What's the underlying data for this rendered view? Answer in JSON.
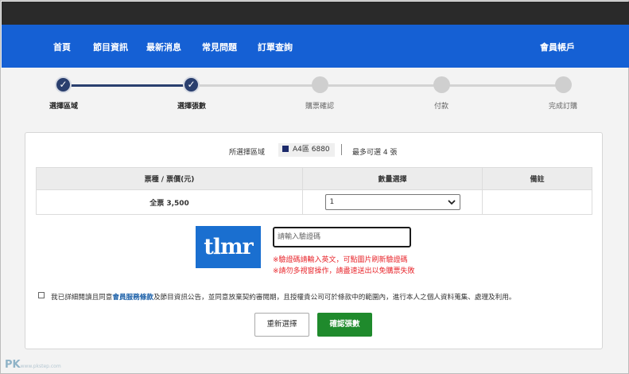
{
  "nav": {
    "items": [
      "首頁",
      "節目資訊",
      "最新消息",
      "常見問題",
      "訂單查詢"
    ],
    "account": "會員帳戶"
  },
  "steps": [
    {
      "label": "選擇區域",
      "done": true,
      "mark": "✓"
    },
    {
      "label": "選擇張數",
      "done": true,
      "mark": "✓"
    },
    {
      "label": "購票確認",
      "done": false,
      "mark": ""
    },
    {
      "label": "付款",
      "done": false,
      "mark": ""
    },
    {
      "label": "完成訂購",
      "done": false,
      "mark": ""
    }
  ],
  "selection": {
    "area_label": "所選擇區域",
    "area_value": "A4區 6880",
    "area_color": "#1c2a6b",
    "max_label": "最多可選 4 張"
  },
  "table": {
    "headers": [
      "票種 / 票價(元)",
      "數量選擇",
      "備註"
    ],
    "rows": [
      {
        "ticket": "全票 3,500",
        "quantity": "1",
        "note": ""
      }
    ]
  },
  "captcha": {
    "image_text": "tlmr",
    "placeholder": "請輸入驗證碼",
    "warnings": [
      "※驗證碼請輸入英文，可點圖片刷新驗證碼",
      "※請勿多視窗操作，請盡速送出以免購票失敗"
    ]
  },
  "agreement": {
    "prefix": "我已詳細閱讀且同意",
    "link": "會員服務條款",
    "suffix": "及節目資訊公告，並同意放棄契約審閱期，且授權貴公司可於條款中的範圍內，進行本人之個人資料蒐集、處理及利用。"
  },
  "buttons": {
    "reset": "重新選擇",
    "confirm": "確認張數"
  },
  "colors": {
    "nav_bg": "#1560d4",
    "step_done": "#2a3f6e",
    "confirm_bg": "#1f8a2c",
    "warning": "#e8252b",
    "link": "#1a5fa8"
  },
  "watermark": {
    "main": "PK",
    "sub": "www.pkstep.com"
  }
}
